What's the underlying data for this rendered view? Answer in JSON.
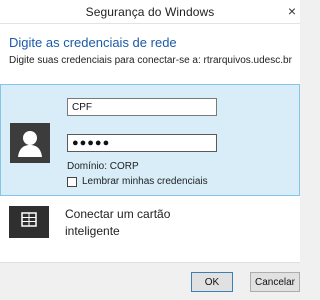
{
  "window": {
    "title": "Segurança do Windows",
    "close_glyph": "×"
  },
  "dialog": {
    "heading": "Digite as credenciais de rede",
    "subtext": "Digite suas credenciais para conectar-se a: rtrarquivos.udesc.br"
  },
  "credential": {
    "username_value": "CPF",
    "password_value": "●●●●●",
    "domain_text": "Domínio: CORP",
    "remember_label": "Lembrar minhas credenciais",
    "remember_checked": false
  },
  "smartcard": {
    "label": "Conectar um cartão inteligente"
  },
  "buttons": {
    "ok_label": "OK",
    "cancel_label": "Cancelar"
  },
  "colors": {
    "heading_blue": "#1a5aa8",
    "tile_background": "#d8edf8",
    "tile_border": "#86c4e8"
  },
  "icons": {
    "user_tile": "user-icon",
    "smartcard": "smartcard-icon",
    "close": "close-icon"
  }
}
